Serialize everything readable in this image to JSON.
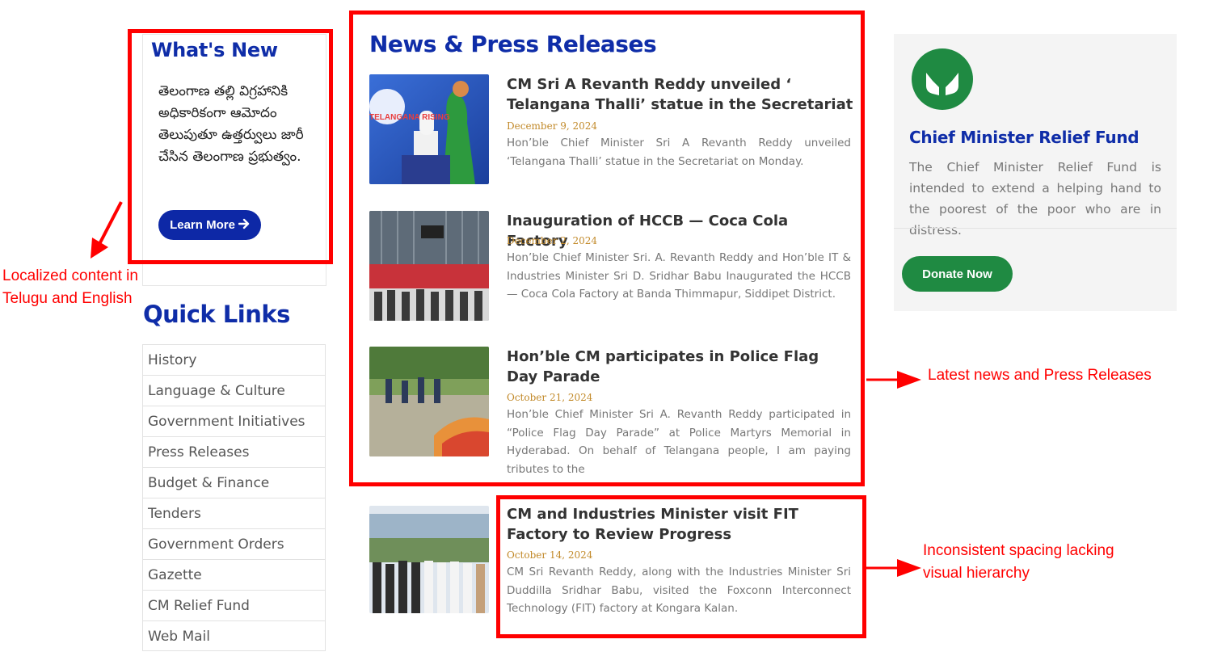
{
  "whats_new": {
    "title": "What's New",
    "telugu_text": "తెలంగాణ తల్లి విగ్రహానికి అధికారికంగా ఆమోదం తెలుపుతూ ఉత్తర్వులు జారీ చేసిన తెలంగాణ ప్రభుత్వం.",
    "learn_more": "Learn More",
    "learn_more_icon": "arrow-right-icon"
  },
  "quick_links": {
    "title": "Quick Links",
    "items": [
      "History",
      "Language & Culture",
      "Government Initiatives",
      "Press Releases",
      "Budget & Finance",
      "Tenders",
      "Government Orders",
      "Gazette",
      "CM Relief Fund",
      "Web Mail"
    ]
  },
  "news": {
    "title": "News & Press Releases",
    "items": [
      {
        "headline": "CM Sri A Revanth Reddy unveiled ‘ Telangana Thalli’ statue in the Secretariat",
        "date": "December 9, 2024",
        "desc": "Hon’ble Chief Minister Sri A Revanth Reddy unveiled ‘Telangana Thalli’ statue in the Secretariat on Monday.",
        "image_text": "TELANGANA RISING"
      },
      {
        "headline": "Inauguration of HCCB — Coca Cola Factory",
        "date": "December 2, 2024",
        "desc": "Hon’ble Chief Minister Sri. A. Revanth Reddy and Hon’ble IT & Industries Minister Sri D. Sridhar Babu Inaugurated the HCCB — Coca Cola Factory at Banda Thimmapur, Siddipet District."
      },
      {
        "headline": "Hon’ble CM participates in Police Flag Day Parade",
        "date": "October 21, 2024",
        "desc": "Hon’ble Chief Minister Sri A. Revanth Reddy participated in “Police Flag Day Parade” at Police Martyrs Memorial in Hyderabad. On behalf of Telangana people, I am paying tributes to the"
      },
      {
        "headline": "CM and Industries Minister visit FIT Factory to Review Progress",
        "date": "October 14, 2024",
        "desc": "CM Sri Revanth Reddy, along with the Industries Minister Sri Duddilla Sridhar Babu, visited the Foxconn Interconnect Technology (FIT) factory at Kongara Kalan."
      }
    ]
  },
  "relief_fund": {
    "icon": "helping-hands-icon",
    "title": "Chief Minister Relief Fund",
    "desc": "The Chief Minister Relief Fund is intended to extend a helping hand to the poorest of the poor who are in distress.",
    "donate": "Donate Now"
  },
  "annotations": {
    "localized": "Localized content in Telugu and English",
    "latest_news": "Latest news and Press Releases",
    "spacing": "Inconsistent spacing lacking visual hierarchy"
  },
  "colors": {
    "brand_blue": "#0f2da8",
    "green": "#1f8a42",
    "date_gold": "#c28a2a",
    "annotation_red": "#ff0000"
  }
}
